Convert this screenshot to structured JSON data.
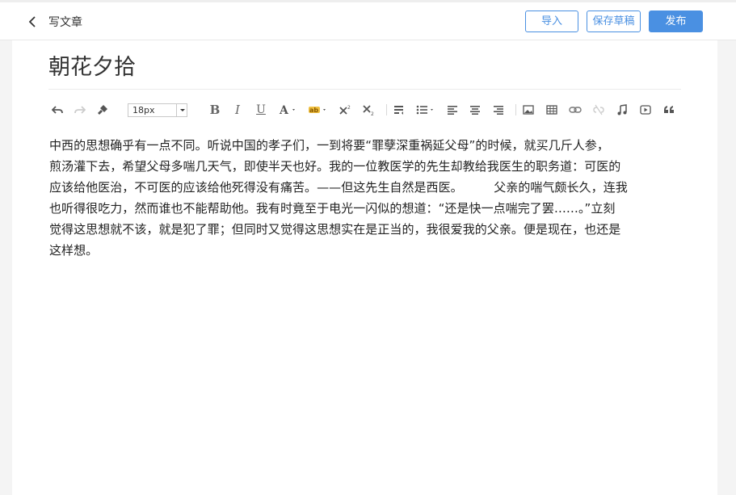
{
  "header": {
    "title": "写文章",
    "import_label": "导入",
    "save_draft_label": "保存草稿",
    "publish_label": "发布"
  },
  "editor": {
    "doc_title": "朝花夕拾",
    "font_size": "18px",
    "toolbar_icons": [
      "undo-icon",
      "redo-icon",
      "format-painter-icon",
      "bold-icon",
      "italic-icon",
      "underline-icon",
      "font-color-icon",
      "highlight-icon",
      "superscript-icon",
      "subscript-icon",
      "paragraph-icon",
      "list-icon",
      "align-left-icon",
      "align-center-icon",
      "align-right-icon",
      "image-icon",
      "table-icon",
      "link-icon",
      "unlink-icon",
      "music-icon",
      "video-icon",
      "quote-icon"
    ],
    "lines": [
      "中西的思想确乎有一点不同。听说中国的孝子们，一到将要“罪孽深重祸延父母”的时候，就买几斤人参，",
      "煎汤灌下去，希望父母多喘几天气，即使半天也好。我的一位教医学的先生却教给我医生的职务道：可医的",
      "应该给他医治，不可医的应该给他死得没有痛苦。——但这先生自然是西医。        父亲的喘气颇长久，连我",
      "也听得很吃力，然而谁也不能帮助他。我有时竟至于电光一闪似的想道：“还是快一点喘完了罢……。”立刻",
      "觉得这思想就不该，就是犯了罪；但同时又觉得这思想实在是正当的，我很爱我的父亲。便是现在，也还是",
      "这样想。"
    ]
  },
  "colors": {
    "accent": "#4a90e2",
    "background": "#f4f4f4"
  }
}
